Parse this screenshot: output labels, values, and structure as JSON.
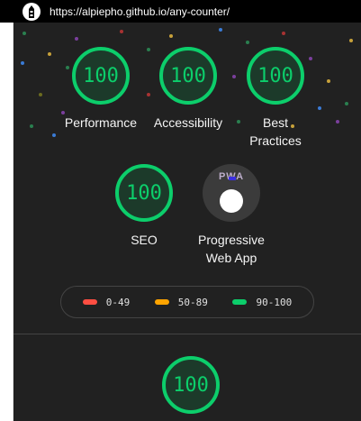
{
  "browser": {
    "url": "https://alpiepho.github.io/any-counter/"
  },
  "scores": [
    {
      "value": "100",
      "label": "Performance"
    },
    {
      "value": "100",
      "label": "Accessibility"
    },
    {
      "value": "100",
      "label_line1": "Best",
      "label_line2": "Practices"
    },
    {
      "value": "100",
      "label": "SEO"
    }
  ],
  "pwa": {
    "badge": "PWA",
    "label_line1": "Progressive",
    "label_line2": "Web App"
  },
  "legend": [
    {
      "range": "0-49",
      "color": "#ff4e42"
    },
    {
      "range": "50-89",
      "color": "#ffa400"
    },
    {
      "range": "90-100",
      "color": "#0cce6b"
    }
  ],
  "bottom_score": {
    "value": "100"
  },
  "colors": {
    "pass": "#0cce6b",
    "background": "#212121"
  }
}
